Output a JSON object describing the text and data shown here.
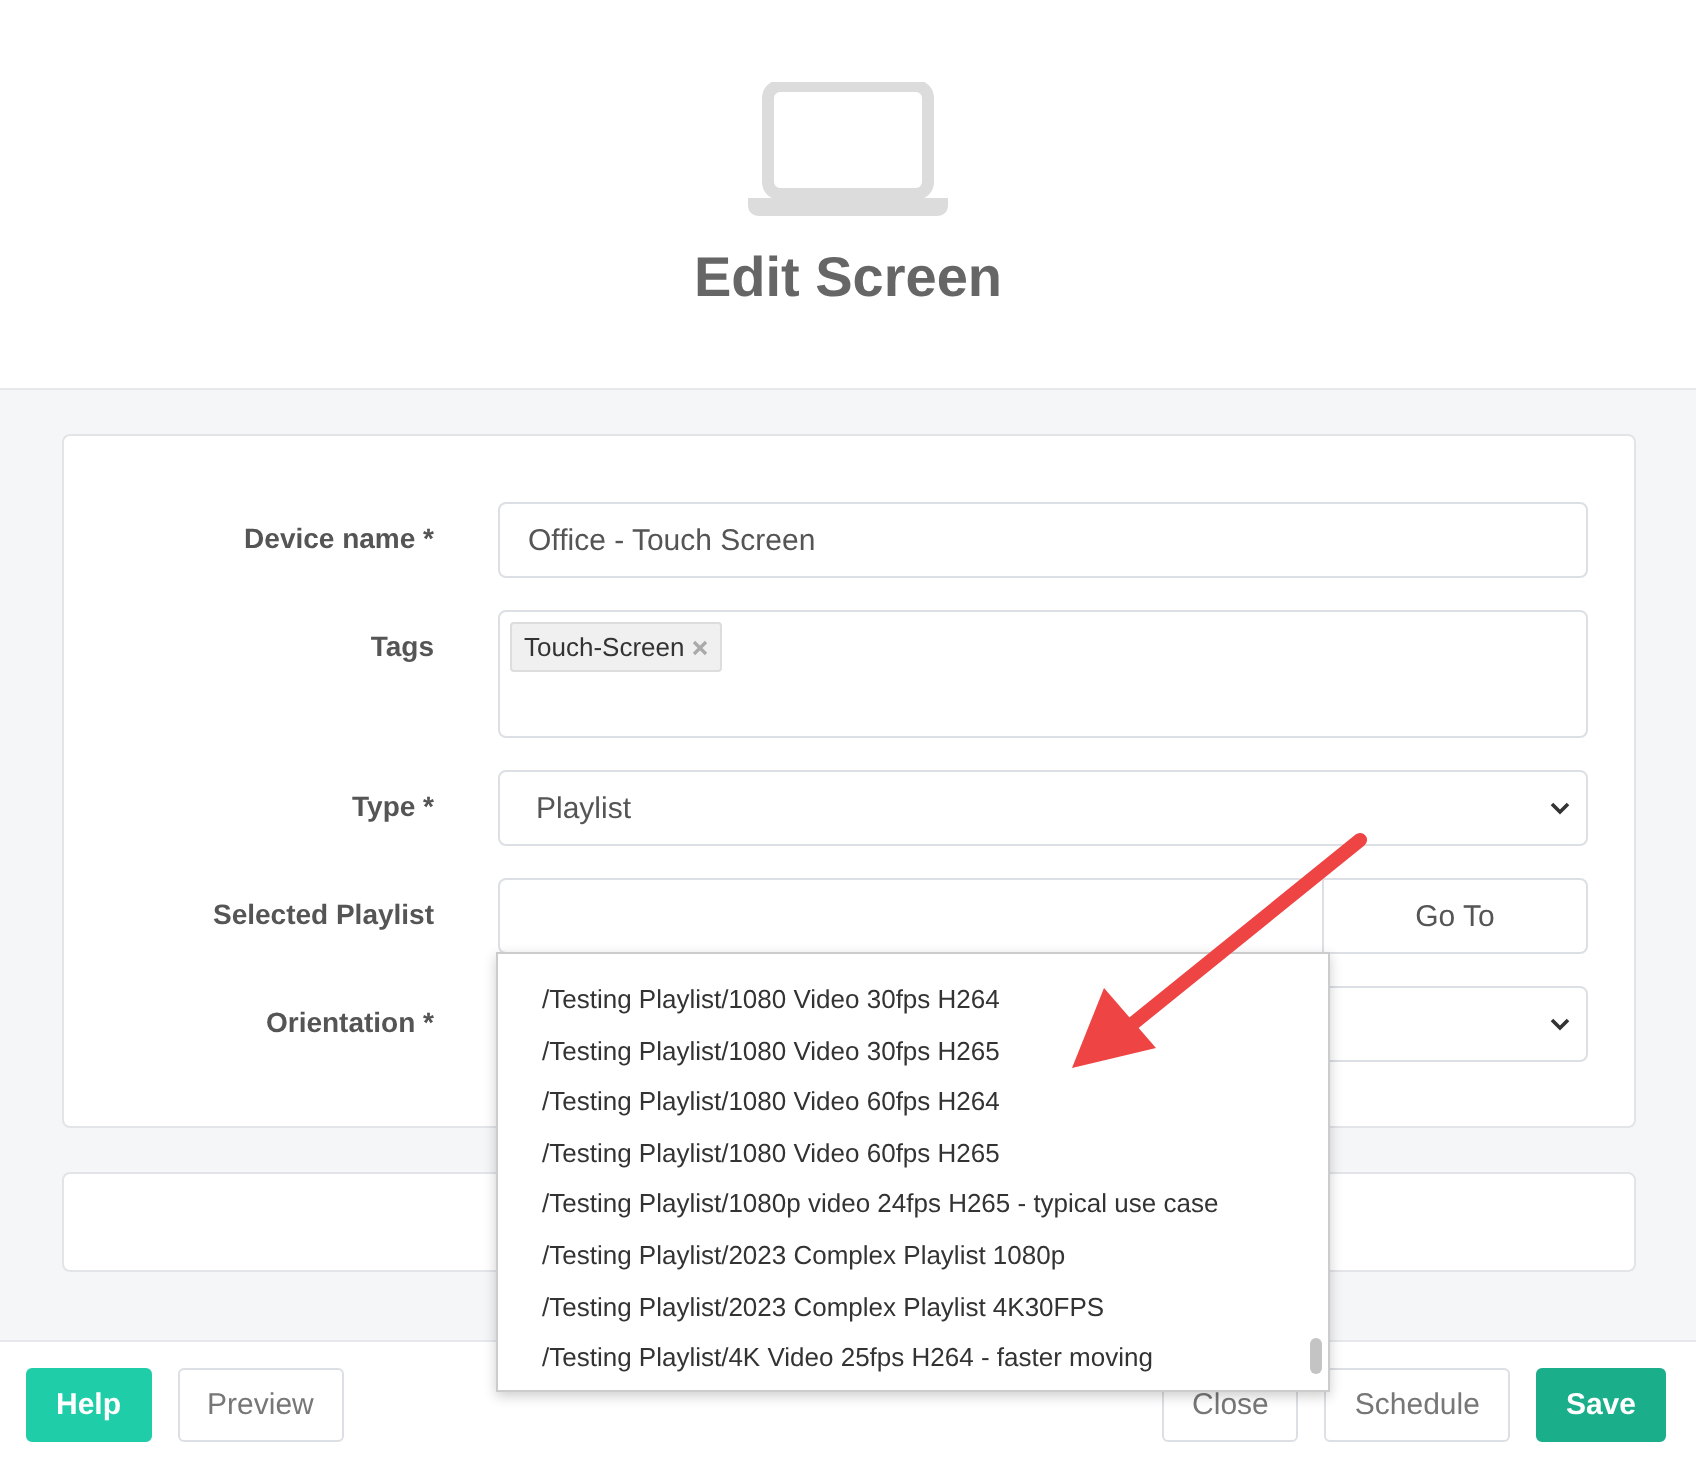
{
  "header": {
    "title": "Edit Screen"
  },
  "form": {
    "device_name": {
      "label": "Device name *",
      "value": "Office - Touch Screen"
    },
    "tags": {
      "label": "Tags",
      "items": [
        "Touch-Screen"
      ]
    },
    "type": {
      "label": "Type *",
      "value": "Playlist"
    },
    "selected_playlist": {
      "label": "Selected Playlist",
      "button": "Go To"
    },
    "orientation": {
      "label": "Orientation *"
    }
  },
  "dropdown": {
    "options": [
      {
        "label": "/Testing Playlist/1080 Video 30fps H264"
      },
      {
        "label": "/Testing Playlist/1080 Video 30fps H265"
      },
      {
        "label": "/Testing Playlist/1080 Video 60fps H264"
      },
      {
        "label": "/Testing Playlist/1080 Video 60fps H265"
      },
      {
        "label": "/Testing Playlist/1080p video 24fps H265 - typical use case"
      },
      {
        "label": "/Testing Playlist/2023 Complex Playlist 1080p"
      },
      {
        "label": "/Testing Playlist/2023 Complex Playlist 4K30FPS"
      },
      {
        "label": "/Testing Playlist/4K Video 25fps H264 - faster moving"
      }
    ]
  },
  "footer": {
    "buttons": [
      {
        "label": "Help",
        "kind": "teal"
      },
      {
        "label": "Preview",
        "kind": "plain"
      },
      {
        "label": "Close",
        "kind": "plain"
      },
      {
        "label": "Schedule",
        "kind": "plain"
      },
      {
        "label": "Save",
        "kind": "green"
      }
    ]
  }
}
